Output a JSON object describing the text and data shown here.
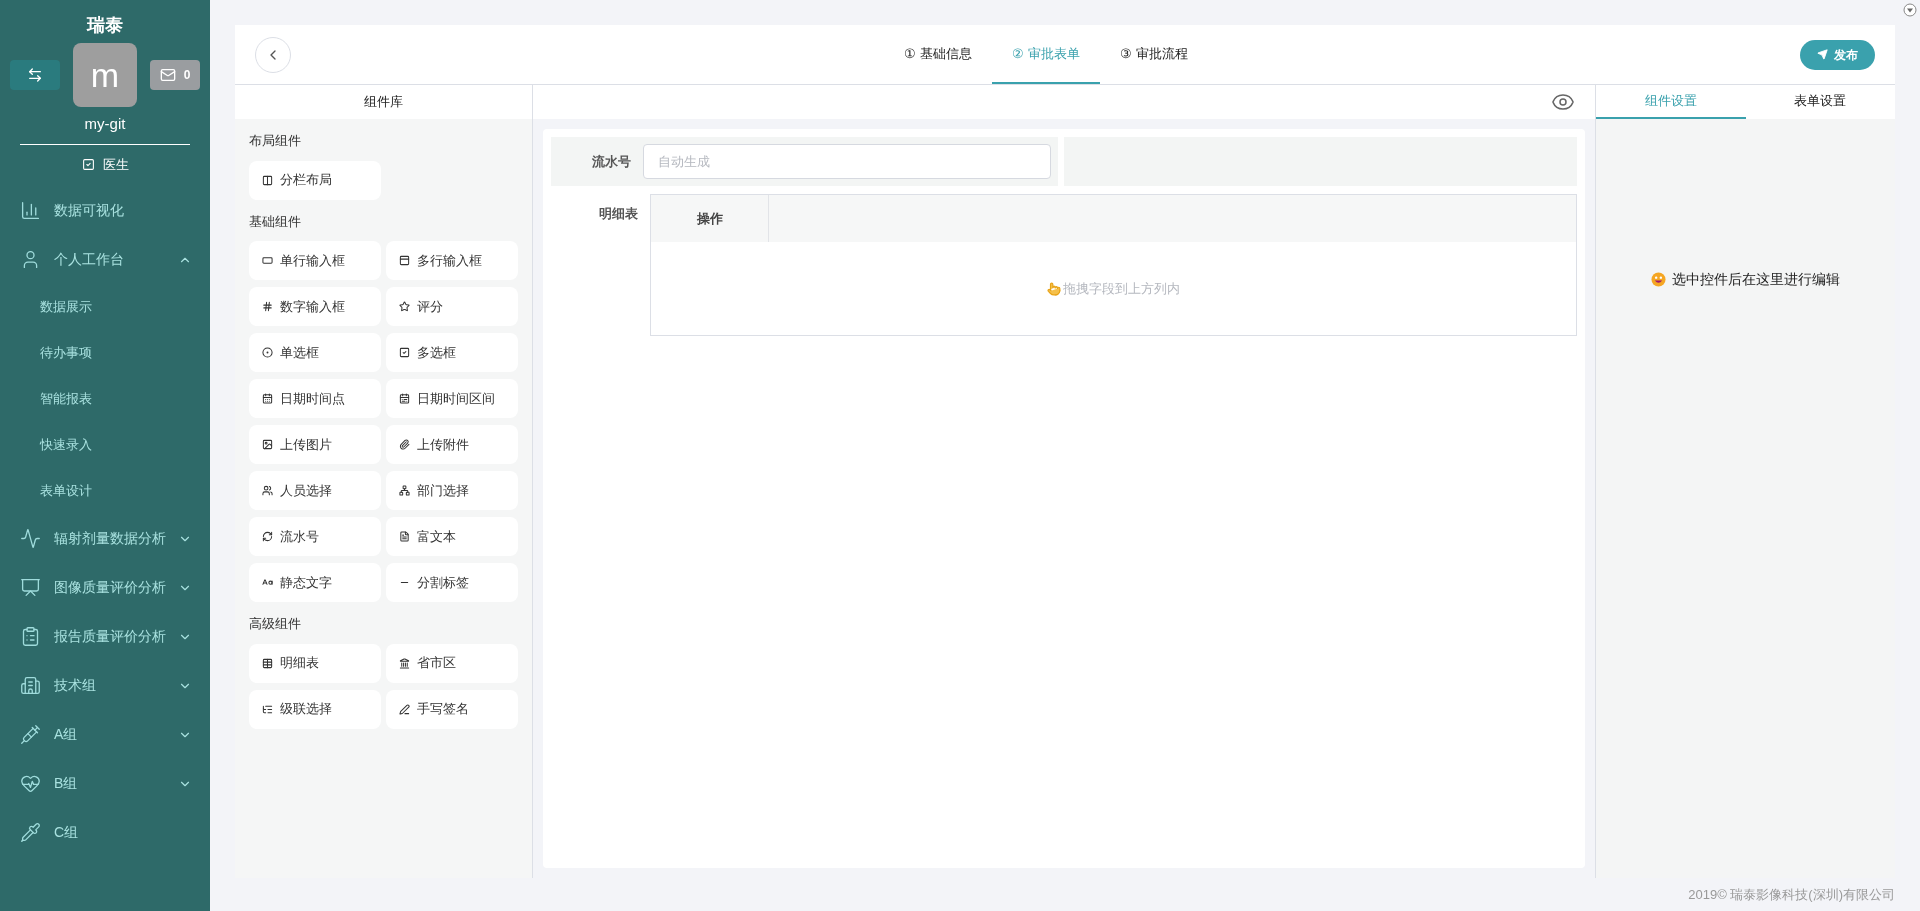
{
  "sidebar": {
    "brand": "瑞泰",
    "user": {
      "avatar_letter": "m",
      "name": "my-git",
      "role": "医生",
      "mail_count": "0"
    },
    "menu": [
      {
        "kind": "link",
        "label": "数据可视化"
      },
      {
        "kind": "group",
        "label": "个人工作台",
        "expanded": true,
        "children": [
          {
            "label": "数据展示"
          },
          {
            "label": "待办事项"
          },
          {
            "label": "智能报表"
          },
          {
            "label": "快速录入"
          },
          {
            "label": "表单设计"
          }
        ]
      },
      {
        "kind": "group",
        "label": "辐射剂量数据分析",
        "expanded": false
      },
      {
        "kind": "group",
        "label": "图像质量评价分析",
        "expanded": false
      },
      {
        "kind": "group",
        "label": "报告质量评价分析",
        "expanded": false
      },
      {
        "kind": "group",
        "label": "技术组",
        "expanded": false
      },
      {
        "kind": "group",
        "label": "A组",
        "expanded": false
      },
      {
        "kind": "group",
        "label": "B组",
        "expanded": false
      },
      {
        "kind": "link",
        "label": "C组"
      }
    ]
  },
  "steps": [
    {
      "number": "①",
      "label": "基础信息",
      "selected": false
    },
    {
      "number": "②",
      "label": "审批表单",
      "selected": true
    },
    {
      "number": "③",
      "label": "审批流程",
      "selected": false
    }
  ],
  "publish_button": "发布",
  "component_library": {
    "title": "组件库",
    "groups": [
      {
        "title": "布局组件",
        "items": [
          "分栏布局"
        ]
      },
      {
        "title": "基础组件",
        "items": [
          "单行输入框",
          "多行输入框",
          "数字输入框",
          "评分",
          "单选框",
          "多选框",
          "日期时间点",
          "日期时间区间",
          "上传图片",
          "上传附件",
          "人员选择",
          "部门选择",
          "流水号",
          "富文本",
          "静态文字",
          "分割标签"
        ]
      },
      {
        "title": "高级组件",
        "items": [
          "明细表",
          "省市区",
          "级联选择",
          "手写签名"
        ]
      }
    ]
  },
  "form": {
    "serial_field": {
      "label": "流水号",
      "placeholder": "自动生成"
    },
    "detail_table": {
      "label": "明细表",
      "column": "操作",
      "empty_hint": "拖拽字段到上方列内"
    }
  },
  "settings_panel": {
    "tabs": [
      {
        "label": "组件设置",
        "selected": true
      },
      {
        "label": "表单设置",
        "selected": false
      }
    ],
    "hint": "选中控件后在这里进行编辑"
  },
  "footer": "2019© 瑞泰影像科技(深圳)有限公司"
}
